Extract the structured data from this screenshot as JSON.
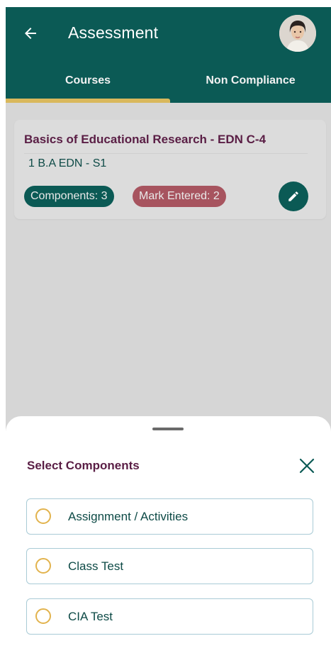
{
  "header": {
    "title": "Assessment",
    "back_icon": "arrow-left-icon",
    "avatar_icon": "user-avatar"
  },
  "tabs": [
    {
      "label": "Courses",
      "active": true
    },
    {
      "label": "Non Compliance",
      "active": false
    }
  ],
  "course": {
    "title": "Basics of Educational Research - EDN C-4",
    "batch": "1 B.A EDN - S1",
    "components_badge": "Components: 3",
    "marks_badge": "Mark Entered: 2",
    "edit_icon": "pencil-icon"
  },
  "sheet": {
    "title": "Select Components",
    "close_icon": "close-icon",
    "options": [
      {
        "label": "Assignment / Activities",
        "selected": false
      },
      {
        "label": "Class Test",
        "selected": false
      },
      {
        "label": "CIA Test",
        "selected": false
      }
    ]
  },
  "colors": {
    "primary": "#0b5a55",
    "accent": "#d9b85c",
    "title_maroon": "#5a1e45",
    "badge_rose": "#a7545f",
    "radio_amber": "#e2b34d"
  }
}
